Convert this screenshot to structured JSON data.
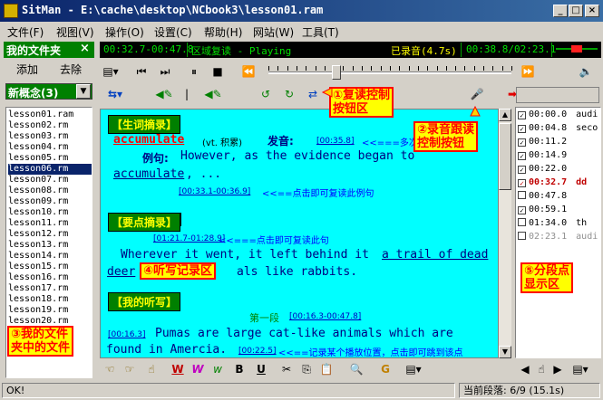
{
  "title": "SitMan - E:\\cache\\desktop\\NCbook3\\lesson01.ram",
  "window_buttons": {
    "minimize": "_",
    "maximize": "□",
    "close": "×"
  },
  "menu": [
    "文件(F)",
    "视图(V)",
    "操作(O)",
    "设置(C)",
    "帮助(H)",
    "网站(W)",
    "工具(T)"
  ],
  "sidebar": {
    "title": "我的文件夹",
    "close": "×",
    "add_label": "添加",
    "remove_label": "去除",
    "folder": "新概念(3)",
    "files": [
      "lesson01.ram",
      "lesson02.rm",
      "lesson03.rm",
      "lesson04.rm",
      "lesson05.rm",
      "lesson06.rm",
      "lesson07.rm",
      "lesson08.rm",
      "lesson09.rm",
      "lesson10.rm",
      "lesson11.rm",
      "lesson12.rm",
      "lesson13.rm",
      "lesson14.rm",
      "lesson15.rm",
      "lesson16.rm",
      "lesson17.rm",
      "lesson18.rm",
      "lesson19.rm",
      "lesson20.rm"
    ],
    "selected_index": 5
  },
  "lcd": {
    "range": "00:32.7-00:47.8",
    "mode": "区域复读 - Playing",
    "record": "已录音(4.7s)",
    "position": "00:38.8/02:23.1"
  },
  "player": {
    "progress_fraction": 0.27
  },
  "editor": {
    "vocab_title": "【生词摘录】",
    "vocab_word": "accumulate",
    "vocab_pos": "(vt. 积累)",
    "pron_label": "发音:",
    "pron_ts": "[00:35.8]",
    "pron_note": "<<===多次",
    "example_label": "例句:",
    "example_line1": "However, as the evidence began to",
    "example_line2_word": "accumulate",
    "example_line2_rest": ", ...",
    "example_ts": "[00:33.1-00:36.9]",
    "example_note": "<<==点击即可复读此例句",
    "points_title": "【要点摘录】",
    "points_ts": "[01:21.7-01:28.9]",
    "points_note": "<<===点击即可复读此句",
    "points_line1_a": "Wherever it went, it left behind it ",
    "points_line1_b": "a trail of dead",
    "points_line2_a": "deer",
    "points_line2_b": "als like rabbits.",
    "dict_title": "【我的听写】",
    "dict_para": "第一段",
    "dict_para_ts": "[00:16.3-00:47.8]",
    "dict_ts1": "[00:16.3]",
    "dict_line1": "Pumas are large cat-like animals which are",
    "dict_line2": "found in Amercia.",
    "dict_ts2": "[00:22.5]",
    "dict_note": "<<==记录某个播放位置，点击即可跳到该点"
  },
  "segments": [
    {
      "time": "00:00.0",
      "text": "audi",
      "checked": true
    },
    {
      "time": "00:04.8",
      "text": "seco",
      "checked": true
    },
    {
      "time": "00:11.2",
      "text": "",
      "checked": true
    },
    {
      "time": "00:14.9",
      "text": "",
      "checked": true
    },
    {
      "time": "00:22.0",
      "text": "",
      "checked": true
    },
    {
      "time": "00:32.7",
      "text": "dd",
      "checked": true,
      "active": true
    },
    {
      "time": "00:47.8",
      "text": "",
      "checked": false
    },
    {
      "time": "00:59.1",
      "text": "",
      "checked": true
    },
    {
      "time": "01:34.0",
      "text": "th",
      "checked": false
    },
    {
      "time": "02:23.1",
      "text": "audi",
      "checked": false,
      "grey": true
    }
  ],
  "callouts": {
    "c1": "①复读控制\n按钮区",
    "c2": "②录音跟读\n控制按钮",
    "c3": "③我的文件\n夹中的文件",
    "c4": "④听写记录区",
    "c5": "⑤分段点\n显示区"
  },
  "status": {
    "left": "OK!",
    "segment": "当前段落: 6/9 (15.1s)"
  }
}
